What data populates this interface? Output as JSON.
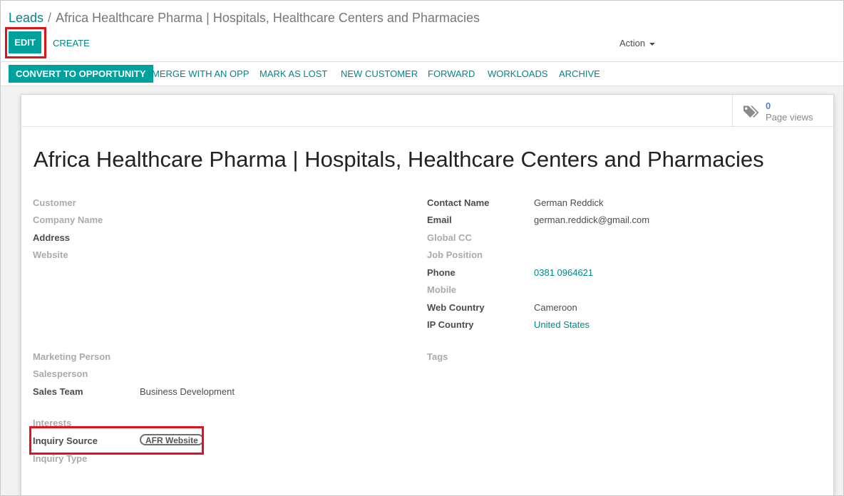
{
  "breadcrumb": {
    "parent": "Leads",
    "separator": "/",
    "current": "Africa Healthcare Pharma | Hospitals, Healthcare Centers and Pharmacies"
  },
  "toolbar": {
    "edit_label": "EDIT",
    "create_label": "CREATE",
    "action_label": "Action"
  },
  "statusbar": {
    "buttons": [
      "CONVERT TO OPPORTUNITY",
      "MERGE WITH AN OPP",
      "MARK AS LOST",
      "NEW CUSTOMER",
      "FORWARD",
      "WORKLOADS",
      "ARCHIVE"
    ]
  },
  "stat_button": {
    "icon": "tags-icon",
    "value": "0",
    "text": "Page views"
  },
  "record": {
    "title": "Africa Healthcare Pharma | Hospitals, Healthcare Centers and Pharmacies"
  },
  "left_fields": {
    "customer": {
      "label": "Customer",
      "value": ""
    },
    "company_name": {
      "label": "Company Name",
      "value": ""
    },
    "address": {
      "label": "Address",
      "value": ""
    },
    "website": {
      "label": "Website",
      "value": ""
    },
    "marketing_person": {
      "label": "Marketing Person",
      "value": ""
    },
    "salesperson": {
      "label": "Salesperson",
      "value": ""
    },
    "sales_team": {
      "label": "Sales Team",
      "value": "Business Development"
    },
    "interests": {
      "label": "Interests",
      "value": ""
    },
    "inquiry_source": {
      "label": "Inquiry Source",
      "value": "AFR Website"
    },
    "inquiry_type": {
      "label": "Inquiry Type",
      "value": ""
    }
  },
  "right_fields": {
    "contact_name": {
      "label": "Contact Name",
      "value": "German Reddick"
    },
    "email": {
      "label": "Email",
      "value": "german.reddick@gmail.com"
    },
    "global_cc": {
      "label": "Global CC",
      "value": ""
    },
    "job_position": {
      "label": "Job Position",
      "value": ""
    },
    "phone": {
      "label": "Phone",
      "value": "0381 0964621"
    },
    "mobile": {
      "label": "Mobile",
      "value": ""
    },
    "web_country": {
      "label": "Web Country",
      "value": "Cameroon"
    },
    "ip_country": {
      "label": "IP Country",
      "value": "United States"
    },
    "tags": {
      "label": "Tags",
      "value": ""
    }
  },
  "colors": {
    "primary": "#00a09d",
    "link": "#00868b",
    "highlight": "#e0121b",
    "stat": "#5b7fc7"
  }
}
